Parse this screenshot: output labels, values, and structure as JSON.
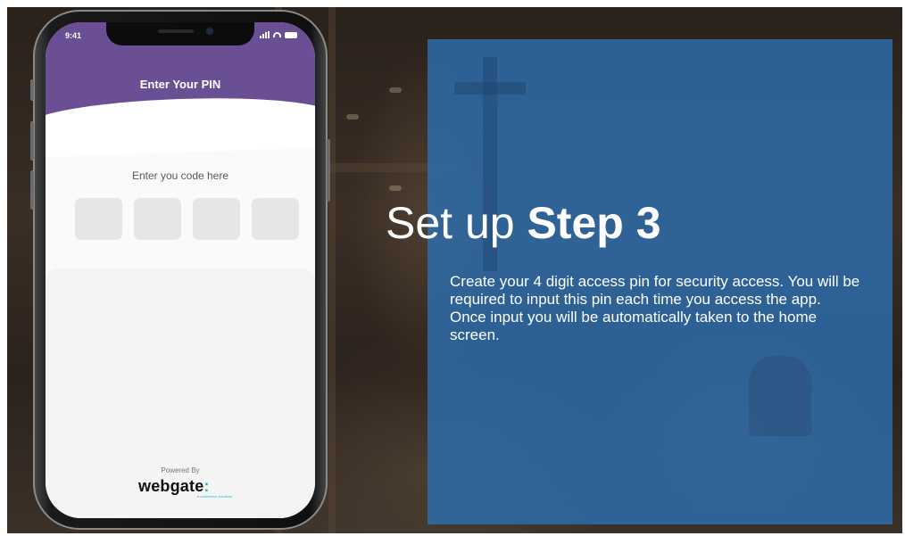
{
  "phone": {
    "status_time": "9:41",
    "header_title": "Enter Your PIN",
    "prompt": "Enter you code here",
    "pin_slots": [
      "",
      "",
      "",
      ""
    ],
    "powered_by": "Powered By",
    "logo_text": "webgate",
    "logo_colon": ":",
    "logo_tagline": "e-commerce solutions"
  },
  "panel": {
    "heading_prefix": "Set up ",
    "heading_bold": "Step 3",
    "description": "Create your 4 digit access pin for security access. You will be required to input this pin each time you access the app. Once input you will be automatically taken to the home screen."
  },
  "colors": {
    "header_purple": "#6b4f95",
    "panel_blue": "#2d6eaf",
    "brand_accent": "#26b7c9"
  }
}
